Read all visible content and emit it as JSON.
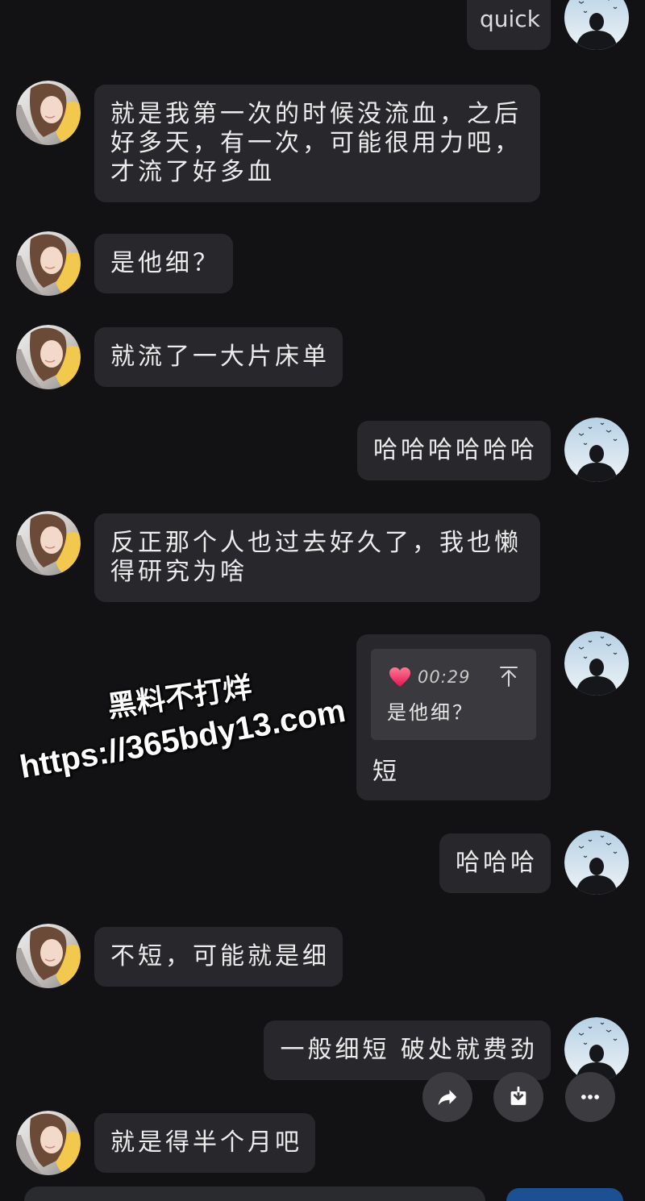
{
  "colors": {
    "background": "#121215",
    "bubble": "#28282c",
    "quote_box": "#3a3a3e",
    "text": "#ececec",
    "action_button": "#3c3c40",
    "send_button": "#1d4f93",
    "heart": "#f0365f"
  },
  "top_partial_message": {
    "text": "quick"
  },
  "messages": [
    {
      "lines": [
        "就是我第一次的时候没流血，之后",
        "好多天，有一次，可能很用力吧，",
        "才流了好多血"
      ]
    },
    {
      "lines": [
        "是他细？"
      ]
    },
    {
      "lines": [
        "就流了一大片床单"
      ]
    },
    {
      "lines": [
        "哈哈哈哈哈哈"
      ]
    },
    {
      "lines": [
        "反正那个人也过去好久了，我也懒",
        "得研究为啥"
      ]
    },
    {
      "reply_to": {
        "icon": "heart-icon",
        "duration": "00:29",
        "text": "是他细？",
        "jump_icon": "arrow-up-to-bar-icon"
      },
      "lines": [
        "短"
      ]
    },
    {
      "lines": [
        "哈哈哈"
      ]
    },
    {
      "lines": [
        "不短，可能就是细"
      ]
    },
    {
      "lines": [
        "一般细短 破处就费劲"
      ]
    },
    {
      "lines": [
        "就是得半个月吧"
      ]
    }
  ],
  "message_actions": [
    {
      "icon": "share-arrow-icon"
    },
    {
      "icon": "download-icon"
    },
    {
      "icon": "more-dots-icon"
    }
  ],
  "watermark": {
    "line1": "黑料不打烊",
    "line2": "https://365bdy13.com"
  }
}
